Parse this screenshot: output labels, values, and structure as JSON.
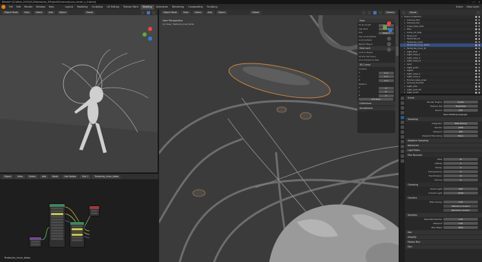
{
  "titlebar": {
    "text": "Blender* [D:\\Work_2019\\01\\20\\tentacles_3\\Project\\Enhanced\\cons_render_v_0.blend]"
  },
  "menubar": {
    "items": [
      "File",
      "Edit",
      "Render",
      "Window",
      "Help"
    ],
    "workspaces": [
      "Layout",
      "Modeling",
      "Sculpting",
      "UV Editing",
      "Texture Paint",
      "Shading",
      "Animation",
      "Rendering",
      "Compositing",
      "Scripting"
    ],
    "active_workspace": "Shading",
    "scene": "Scene",
    "view_layer": "View Layer"
  },
  "left_viewport": {
    "mode": "Object Mode",
    "view": "View",
    "select": "Select",
    "add": "Add",
    "object": "Object",
    "orientation": "Global"
  },
  "main_viewport": {
    "mode": "Object Mode",
    "view": "View",
    "select": "Select",
    "add": "Add",
    "object": "Object",
    "orientation": "Global",
    "overlay_title": "User Perspective",
    "overlay_sub": "(1) View | Tentacle_Inner_Slide",
    "options": "Options"
  },
  "npanel": {
    "view_title": "View",
    "focal_label": "Focal Length",
    "focal_val": "50 mm",
    "clip_start_label": "Clip Start",
    "clip_start_val": "0.01 m",
    "clip_end_label": "End",
    "clip_end_val": "1000 m",
    "local_camera": "Use Local Camera",
    "local_camera2": "Local Camera",
    "render_region": "Render Region",
    "view_lock": "View Lock",
    "lock_obj": "Lock to Object",
    "lock_3d": "Lock to 3D Cursor",
    "lock_cam": "Lock Camera to View",
    "cursor_title": "3D Cursor",
    "location": "Location",
    "x": "X",
    "y": "Y",
    "z": "Z",
    "xv": "0 m",
    "yv": "0 m",
    "zv": "0 m",
    "rotation": "Rotation",
    "rx": "0°",
    "ry": "0°",
    "rz": "0°",
    "rot_mode": "XYZ Euler",
    "collections": "Collections",
    "annotations": "Annotations"
  },
  "node_editor": {
    "mode": "Object",
    "view": "View",
    "select": "Select",
    "add": "Add",
    "node": "Node",
    "use_nodes": "Use Nodes",
    "slot": "Slot 1",
    "material": "Tentacles_inner_blobs",
    "footer": "Tentacles_inner_blobs"
  },
  "outliner": {
    "title": "Scene",
    "rows": [
      {
        "name": "Scene Collection",
        "sel": false
      },
      {
        "name": "Camera_001",
        "sel": false
      },
      {
        "name": "Camera_top",
        "sel": false
      },
      {
        "name": "Cube_base_blob",
        "sel": false
      },
      {
        "name": "Plan",
        "sel": false
      },
      {
        "name": "Lotus_Lit_Ship",
        "sel": false
      },
      {
        "name": "Sand_out",
        "sel": false
      },
      {
        "name": "Tentacles_01",
        "sel": false
      },
      {
        "name": "Tentacles_outer",
        "sel": false
      },
      {
        "name": "Tentacles_inner_blobs",
        "sel": true
      },
      {
        "name": "Tentacles_inner_lit",
        "sel": false
      },
      {
        "name": "Light_floor",
        "sel": false
      },
      {
        "name": "Light_area_2",
        "sel": false
      },
      {
        "name": "Light_area_3",
        "sel": false
      },
      {
        "name": "Light_area_r2",
        "sel": false
      },
      {
        "name": "Spot",
        "sel": false
      },
      {
        "name": "Light_point",
        "sel": false
      },
      {
        "name": "Lights",
        "sel": false
      },
      {
        "name": "Light_area_1",
        "sel": false
      },
      {
        "name": "Light_area_2",
        "sel": false
      },
      {
        "name": "Human_base_pose",
        "sel": false
      },
      {
        "name": "Camera_Portrait",
        "sel": false
      },
      {
        "name": "Light_side",
        "sel": false
      },
      {
        "name": "Light_spot_fill",
        "sel": false
      },
      {
        "name": "Light_point",
        "sel": false
      },
      {
        "name": "Light_spot_3",
        "sel": false
      }
    ]
  },
  "properties": {
    "title": "Scene",
    "render_engine_label": "Render Engine",
    "render_engine": "Cycles",
    "feature_set_label": "Feature Set",
    "feature_set": "Supported",
    "device_label": "Device",
    "device": "CPU",
    "open_shading": "Open Shading Language",
    "sampling": "Sampling",
    "integrator_label": "Integrator",
    "integrator": "Path Tracing",
    "render_label": "Render",
    "render_val": "1250",
    "viewport_label": "Viewport",
    "viewport_val": "200",
    "viewport_denoise_label": "Viewport Denoising",
    "viewport_denoise": "None",
    "adaptive": "Adaptive Sampling",
    "advanced": "Advanced",
    "light_paths": "Light Paths",
    "max_bounces": "Max Bounces",
    "total_label": "Total",
    "total_val": "12",
    "diffuse_label": "Diffuse",
    "diffuse_val": "4",
    "glossy_label": "Glossy",
    "glossy_val": "4",
    "transparency_label": "Transparency",
    "transparency_val": "8",
    "transmission_label": "Transmission",
    "transmission_val": "12",
    "volume_label": "Volume",
    "volume_val": "0",
    "clamping": "Clamping",
    "direct_label": "Direct Light",
    "direct_val": "0.00",
    "indirect_label": "Indirect Light",
    "indirect_val": "10.00",
    "caustics": "Caustics",
    "filter_glossy_label": "Filter Glossy",
    "filter_glossy_val": "1.00",
    "refl_caustics": "Reflective Caustics",
    "refr_caustics": "Refractive Caustics",
    "volumes": "Volumes",
    "step_rate_render_label": "Step Rate Render",
    "step_rate_render_val": "1.00",
    "step_viewport_label": "Viewport",
    "step_viewport_val": "1.00",
    "max_steps_label": "Max Steps",
    "max_steps_val": "1024",
    "hair": "Hair",
    "simplify": "Simplify",
    "motion_blur": "Motion Blur",
    "film": "Film"
  },
  "colors": {
    "accent": "#e87d0d",
    "selection": "#334d80",
    "ui_dark": "#282828"
  }
}
